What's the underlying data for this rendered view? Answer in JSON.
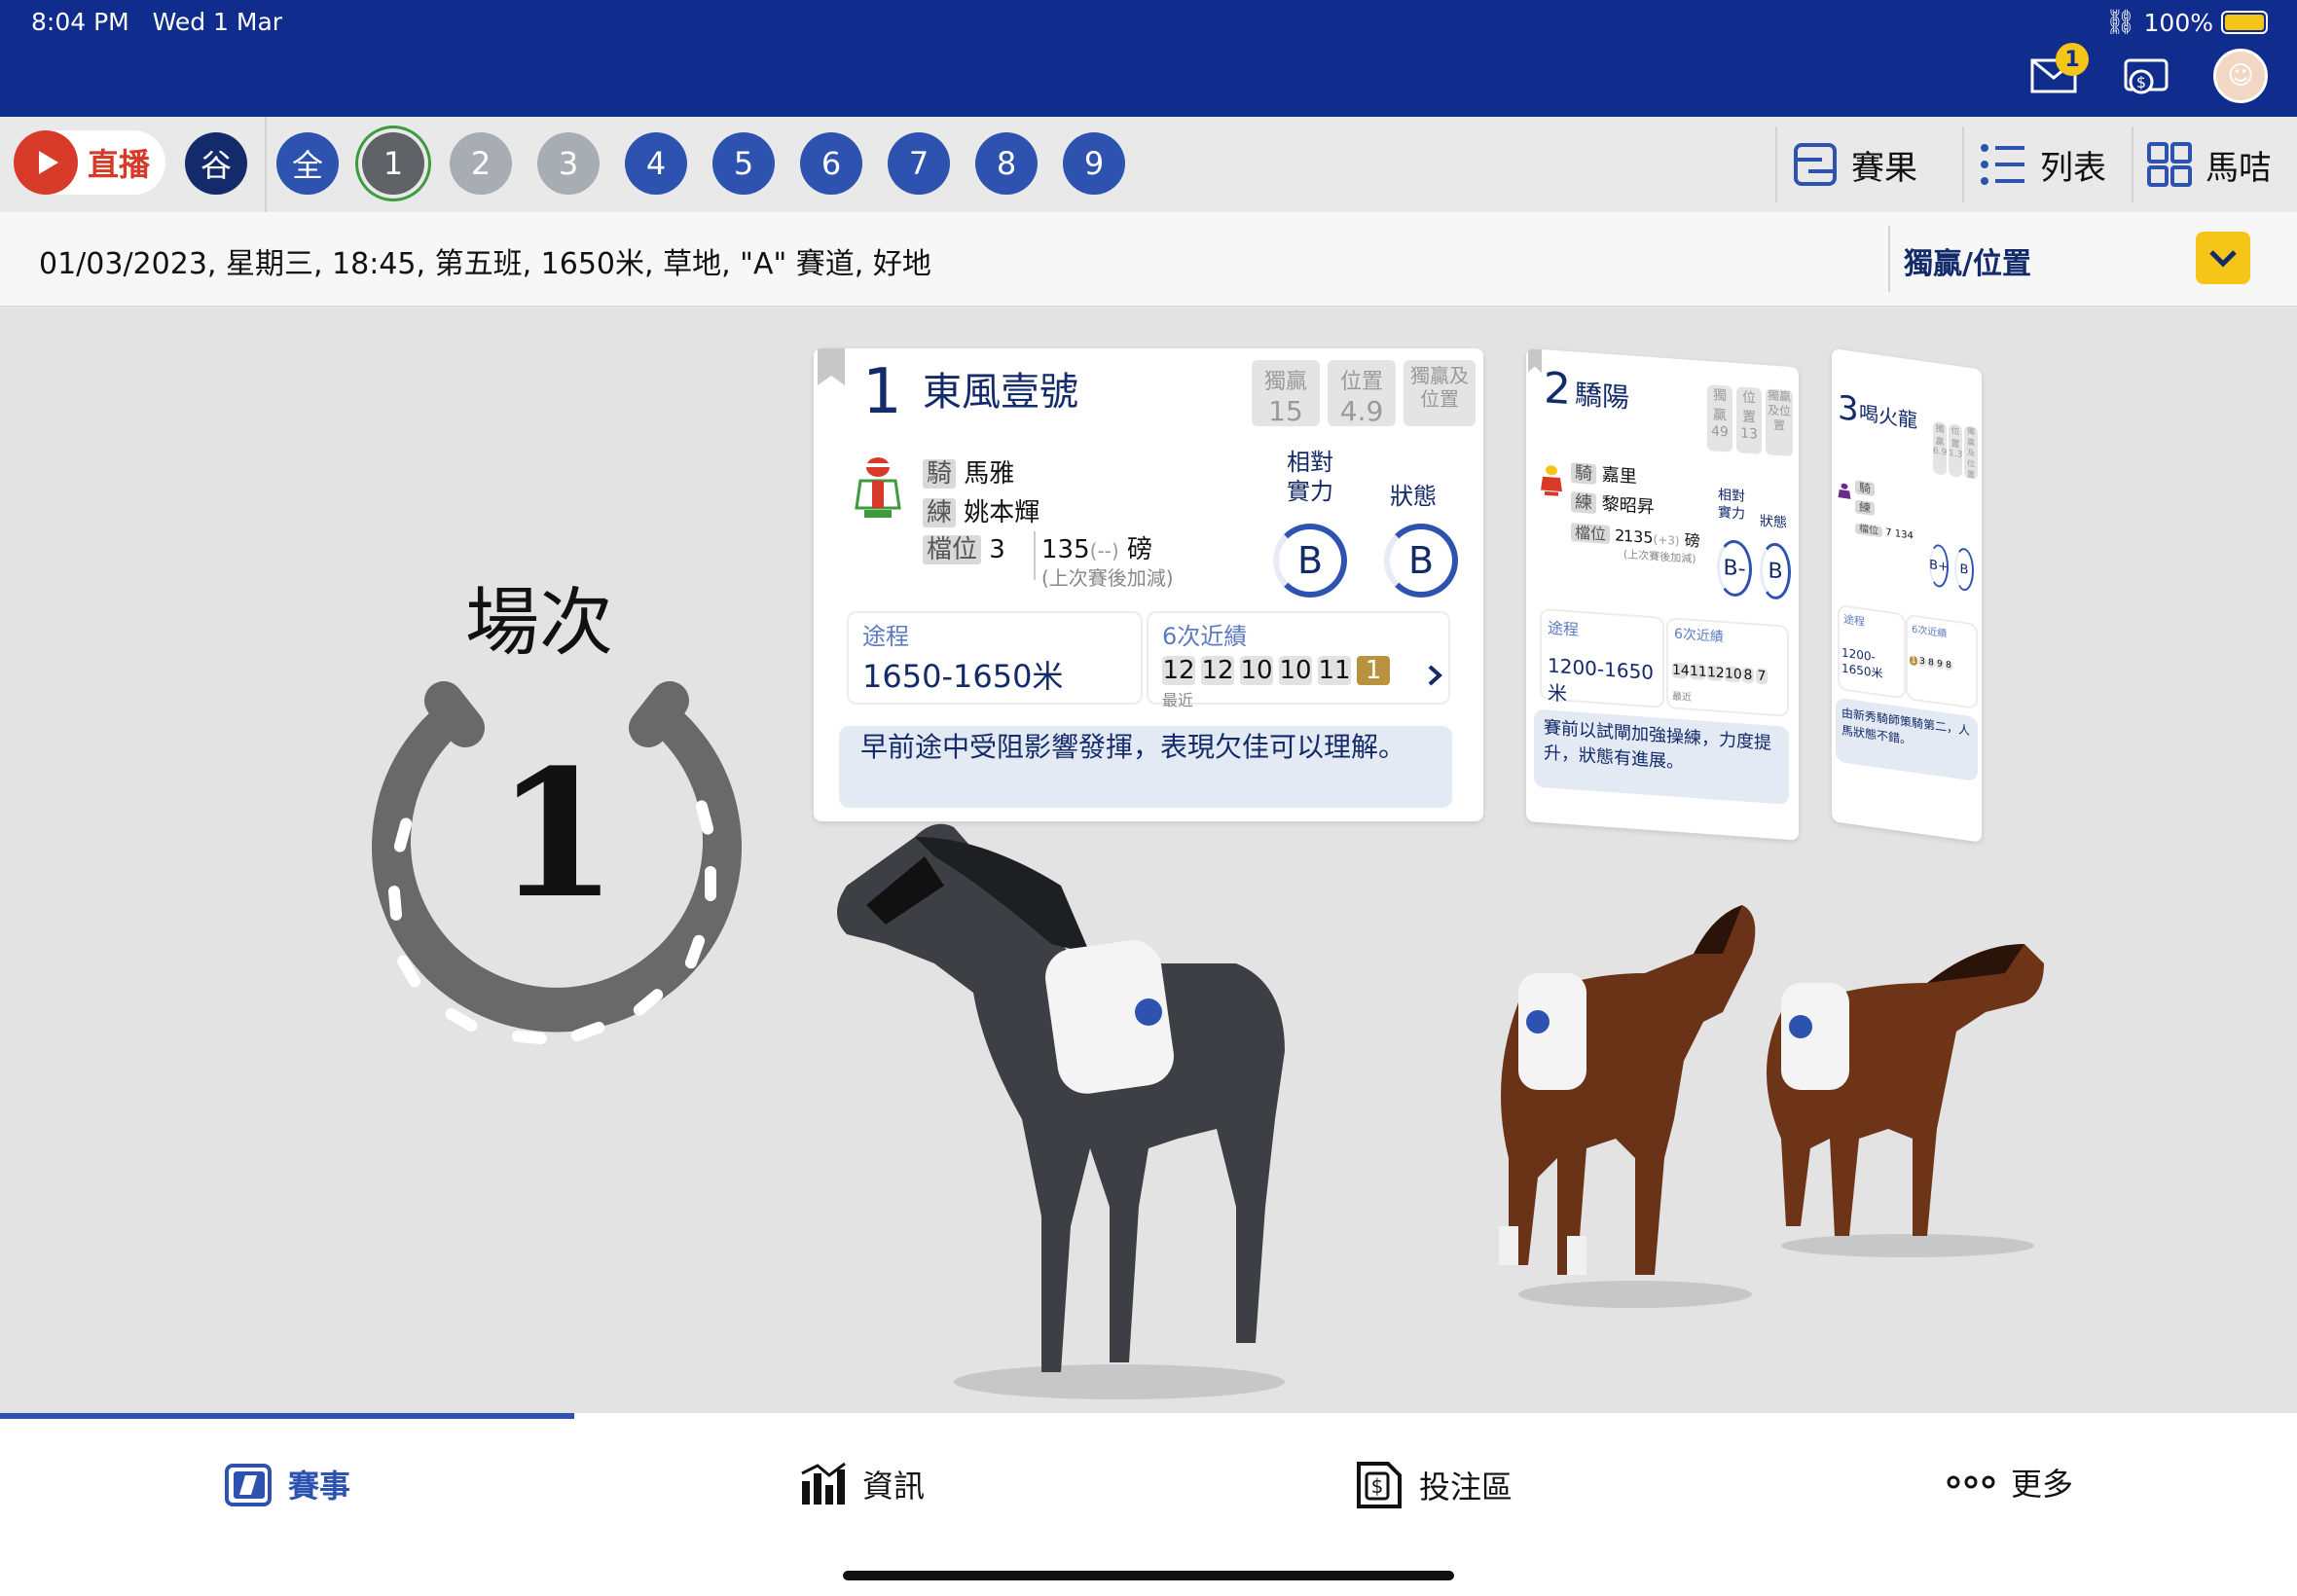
{
  "status": {
    "time": "8:04 PM",
    "date": "Wed 1 Mar",
    "battery": "100%",
    "mail_badge": "1"
  },
  "racebar": {
    "live_label": "直播",
    "venue": "谷",
    "races": [
      "全",
      "1",
      "2",
      "3",
      "4",
      "5",
      "6",
      "7",
      "8",
      "9"
    ],
    "current": "1",
    "results_label": "賽果",
    "list_label": "列表",
    "horse_info_label": "馬咭"
  },
  "info": {
    "race_details": "01/03/2023, 星期三, 18:45, 第五班, 1650米, 草地, \"A\" 賽道, 好地",
    "pool": "獨贏/位置"
  },
  "stage": {
    "race_label": "場次",
    "race_number": "1"
  },
  "cards": [
    {
      "number": "1",
      "name": "東風壹號",
      "odds": [
        {
          "label": "獨贏",
          "value": "15"
        },
        {
          "label": "位置",
          "value": "4.9"
        },
        {
          "label": "獨贏及位置",
          "value": ""
        }
      ],
      "jockey_tag": "騎",
      "jockey": "馬雅",
      "trainer_tag": "練",
      "trainer": "姚本輝",
      "draw_tag": "檔位",
      "draw": "3",
      "weight": "135",
      "weight_change": "(--)",
      "weight_unit": "磅",
      "weight_note": "(上次賽後加減)",
      "rating_label": "相對實力",
      "rating": "B",
      "form_label": "狀態",
      "form": "B",
      "distance_label": "途程",
      "distance": "1650-1650米",
      "recent_label": "6次近績",
      "recent": [
        "12",
        "12",
        "10",
        "10",
        "11",
        "1"
      ],
      "recent_note": "最近",
      "comment": "早前途中受阻影響發揮，表現欠佳可以理解。"
    },
    {
      "number": "2",
      "name": "驕陽",
      "odds": [
        {
          "label": "獨贏",
          "value": "49"
        },
        {
          "label": "位置",
          "value": "13"
        },
        {
          "label": "獨贏及位置",
          "value": ""
        }
      ],
      "jockey_tag": "騎",
      "jockey": "嘉里",
      "trainer_tag": "練",
      "trainer": "黎昭昇",
      "draw_tag": "檔位",
      "draw": "2",
      "weight": "135",
      "weight_change": "(+3)",
      "weight_unit": "磅",
      "weight_note": "(上次賽後加減)",
      "rating_label": "相對實力",
      "rating": "B-",
      "form_label": "狀態",
      "form": "B",
      "distance_label": "途程",
      "distance": "1200-1650米",
      "recent_label": "6次近績",
      "recent": [
        "14",
        "11",
        "12",
        "10",
        "8",
        "7"
      ],
      "recent_note": "最近",
      "comment": "賽前以試閘加強操練，力度提升，狀態有進展。"
    },
    {
      "number": "3",
      "name": "喝火龍",
      "odds": [
        {
          "label": "獨贏",
          "value": "6.9"
        },
        {
          "label": "位置",
          "value": "1.3"
        },
        {
          "label": "獨贏及位置",
          "value": ""
        }
      ],
      "jockey_tag": "騎",
      "jockey": "",
      "trainer_tag": "練",
      "trainer": "",
      "draw_tag": "檔位",
      "draw": "7",
      "weight": "134",
      "rating": "B+",
      "form": "B",
      "distance_label": "途程",
      "distance": "1200-1650米",
      "recent_label": "6次近績",
      "recent": [
        "1",
        "3",
        "8",
        "9",
        "8"
      ],
      "comment": "由新秀騎師策騎第二，人馬狀態不錯。"
    }
  ],
  "bottom_nav": [
    {
      "label": "賽事",
      "icon": "race-icon"
    },
    {
      "label": "資訊",
      "icon": "stats-icon"
    },
    {
      "label": "投注區",
      "icon": "betting-icon"
    },
    {
      "label": "更多",
      "icon": "more-icon"
    }
  ],
  "colors": {
    "brand_navy": "#102c8c",
    "accent_blue": "#2d52b0",
    "live_red": "#d83a2a",
    "gold": "#f5c518"
  }
}
